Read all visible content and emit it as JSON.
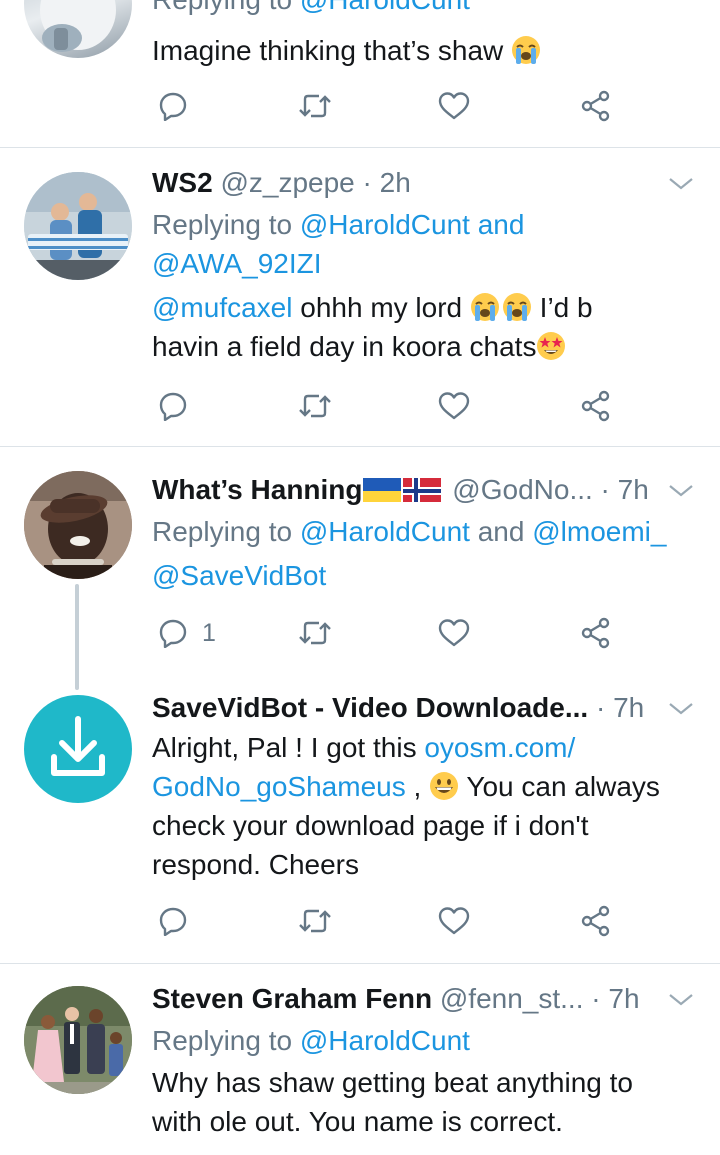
{
  "tweets": [
    {
      "reply_to": "Replying to ",
      "reply_link": "@HaroldCunt",
      "text": "Imagine thinking that’s shaw "
    },
    {
      "name": "WS2",
      "handle": "@z_zpepe",
      "sep": " · ",
      "time": "2h",
      "reply_to": "Replying to ",
      "reply_link_1": "@HaroldCunt",
      "reply_and": " and",
      "reply_link_2": "@AWA_92IZI",
      "mention": "@mufcaxel",
      "text_1": " ohhh my lord ",
      "text_2": " I’d b",
      "text_3": "havin a field day in koora chats"
    },
    {
      "name": "What’s Hanning",
      "handle": "@GodNo...",
      "sep": " · ",
      "time": "7h",
      "reply_to": "Replying to ",
      "reply_link_1": "@HaroldCunt",
      "reply_and": " and ",
      "reply_link_2": "@lmoemi_",
      "reply_link_3": "@SaveVidBot",
      "reply_count": "1"
    },
    {
      "name": "SaveVidBot - Video Downloade...",
      "sep": " · ",
      "time": "7h",
      "text_1": "Alright, Pal ! I got this ",
      "link_1": "oyosm.com/",
      "link_2": "GodNo_goShameus",
      "text_2": " , ",
      "text_3": " You can always",
      "text_4": "check your download page if i don't",
      "text_5": "respond. Cheers"
    },
    {
      "name": "Steven Graham Fenn",
      "handle": "@fenn_st...",
      "sep": " · ",
      "time": "7h",
      "reply_to": "Replying to ",
      "reply_link": "@HaroldCunt",
      "text_1": "Why has shaw getting beat anything to",
      "text_2": "with ole out. You name is correct."
    }
  ],
  "colors": {
    "link": "#1b95e0",
    "secondary": "#657786",
    "text": "#14171a",
    "divider": "#dde3e8",
    "download_avatar": "#1fb8c9"
  },
  "icons": [
    "reply-icon",
    "retweet-icon",
    "like-icon",
    "share-icon",
    "chevron-down-icon",
    "download-icon",
    "loudly-crying-face-emoji",
    "star-struck-emoji",
    "grinning-face-emoji",
    "ukraine-flag",
    "norway-flag"
  ]
}
